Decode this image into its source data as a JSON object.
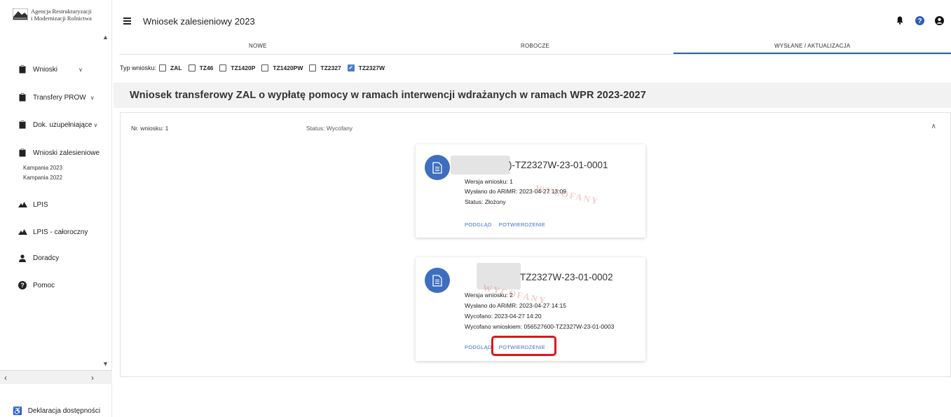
{
  "sidebar": {
    "logo": {
      "line1": "Agencja Restrukturyzacji",
      "line2": "i Modernizacji Rolnictwa"
    },
    "items": [
      {
        "label": "Wnioski",
        "icon": "clipboard-icon",
        "has_chevron": true
      },
      {
        "label": "Transfery PROW",
        "icon": "clipboard-icon",
        "has_chevron": true
      },
      {
        "label": "Dok. uzupełniające",
        "icon": "clipboard-icon",
        "has_chevron": true
      },
      {
        "label": "Wnioski zalesieniowe",
        "icon": "clipboard-icon",
        "has_chevron": false
      },
      {
        "label": "LPIS",
        "icon": "mountain-icon"
      },
      {
        "label": "LPIS - całoroczny",
        "icon": "mountain-icon"
      },
      {
        "label": "Doradcy",
        "icon": "person-icon"
      },
      {
        "label": "Pomoc",
        "icon": "help-icon"
      }
    ],
    "sub_items": [
      "Kampania 2023",
      "Kampania 2022"
    ],
    "bottom": {
      "label": "Deklaracja dostępności",
      "icon": "accessibility-icon"
    }
  },
  "topbar": {
    "title": "Wniosek zalesieniowy 2023",
    "icons": [
      "bell-icon",
      "help-icon",
      "account-icon"
    ]
  },
  "tabs": [
    {
      "label": "NOWE",
      "active": false
    },
    {
      "label": "ROBOCZE",
      "active": false
    },
    {
      "label": "WYSŁANE / AKTUALIZACJA",
      "active": true
    }
  ],
  "filters": {
    "label": "Typ wniosku:",
    "options": [
      {
        "label": "ZAL",
        "checked": false
      },
      {
        "label": "TZ46",
        "checked": false
      },
      {
        "label": "TZ1420P",
        "checked": false
      },
      {
        "label": "TZ1420PW",
        "checked": false
      },
      {
        "label": "TZ2327",
        "checked": false
      },
      {
        "label": "TZ2327W",
        "checked": true
      }
    ]
  },
  "section": {
    "title": "Wniosek transferowy  ZAL o wypłatę pomocy w ramach interwencji wdrażanych w ramach WPR 2023-2027"
  },
  "panel": {
    "nr": "Nr. wniosku: 1",
    "status": "Status: Wycofany"
  },
  "cards": [
    {
      "number": ")-TZ2327W-23-01-0001",
      "lines": [
        "Wersja wniosku: 1",
        "Wysłano do ARiMR: 2023-04-27 13:09",
        "Status: Złożony"
      ],
      "actions": [
        "PODGLĄD",
        "POTWIERDZENIE"
      ],
      "stamp": "WYCOFANY"
    },
    {
      "number": "TZ2327W-23-01-0002",
      "lines": [
        "Wersja wniosku: 2",
        "Wysłano do ARiMR: 2023-04-27 14:15",
        "Wycofano: 2023-04-27 14:20",
        "Wycofano wnioskiem: 056527600-TZ2327W-23-01-0003"
      ],
      "actions": [
        "PODGLĄD",
        "POTWIERDZENIE"
      ],
      "stamp": "WYCOFANY"
    }
  ],
  "colors": {
    "accent": "#3d6ec0",
    "highlight": "#e0141c",
    "section_bg": "#f2f2f2"
  }
}
